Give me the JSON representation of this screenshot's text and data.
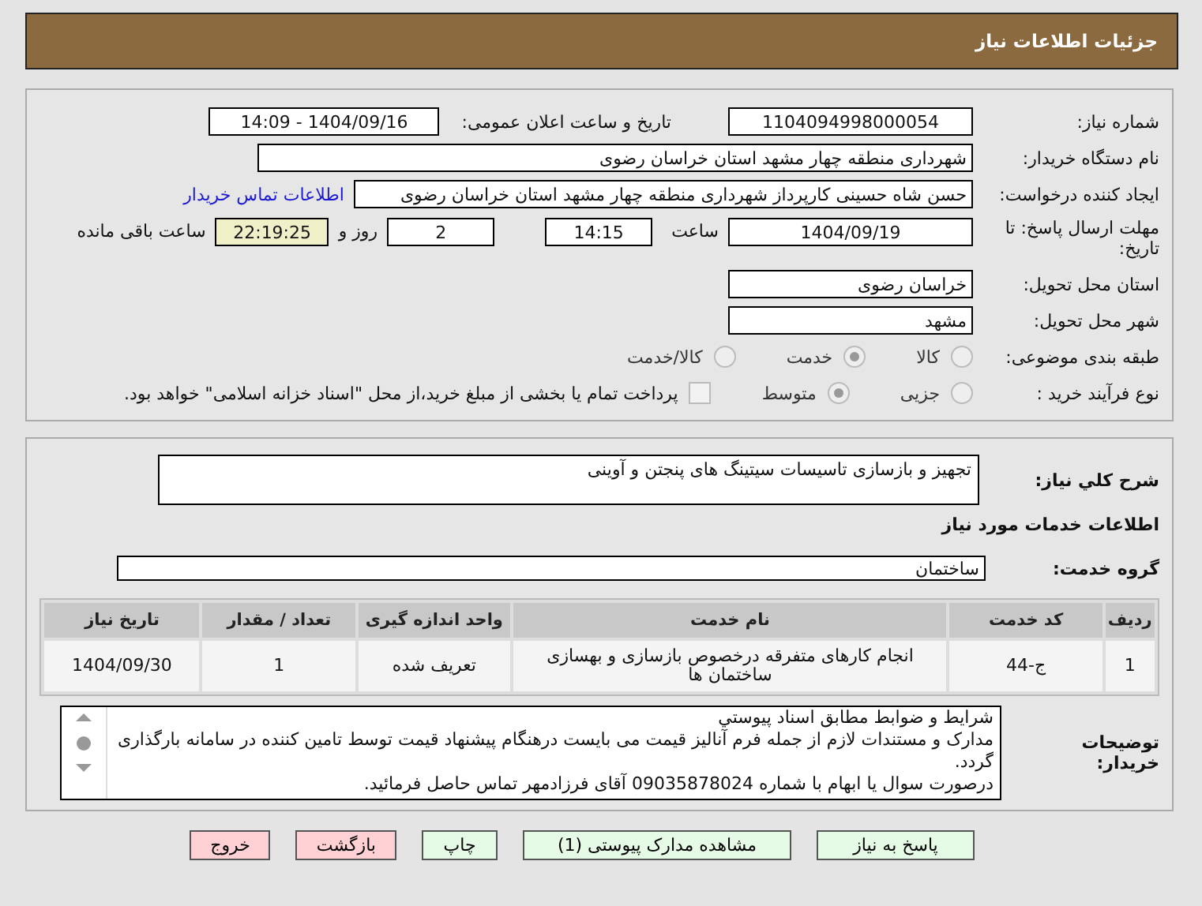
{
  "header": {
    "title": "جزئیات اطلاعات نیاز"
  },
  "details": {
    "need_number": {
      "label": "شماره نیاز:",
      "value": "1104094998000054"
    },
    "announce": {
      "label": "تاریخ و ساعت اعلان عمومی:",
      "value": "1404/09/16 - 14:09"
    },
    "buyer": {
      "label": "نام دستگاه خریدار:",
      "value": "شهرداری منطقه چهار مشهد استان خراسان رضوی"
    },
    "requester": {
      "label": "ایجاد کننده درخواست:",
      "value": "حسن شاه حسینی کارپرداز شهرداری منطقه چهار مشهد استان خراسان رضوی",
      "link": "اطلاعات تماس خریدار"
    },
    "deadline": {
      "label": "مهلت ارسال پاسخ: تا تاریخ:",
      "date": "1404/09/19",
      "time_label": "ساعت",
      "time": "14:15",
      "days": "2",
      "days_label": "روز و",
      "remaining": "22:19:25",
      "remaining_label": "ساعت باقی مانده"
    },
    "province": {
      "label": "استان محل تحویل:",
      "value": "خراسان رضوی"
    },
    "city": {
      "label": "شهر محل تحویل:",
      "value": "مشهد"
    },
    "category": {
      "label": "طبقه بندی موضوعی:",
      "options": [
        {
          "label": "کالا",
          "selected": false
        },
        {
          "label": "خدمت",
          "selected": true
        },
        {
          "label": "کالا/خدمت",
          "selected": false
        }
      ]
    },
    "purchase_type": {
      "label": "نوع فرآیند خرید :",
      "options": [
        {
          "label": "جزیی",
          "selected": false
        },
        {
          "label": "متوسط",
          "selected": true
        }
      ],
      "payment": {
        "checked": false,
        "text": "پرداخت تمام یا بخشی از مبلغ خرید،از محل \"اسناد خزانه اسلامی\" خواهد بود."
      }
    }
  },
  "services": {
    "description": {
      "label": "شرح کلي نياز:",
      "value": "تجهیز و بازسازی تاسیسات سیتینگ های پنجتن و آوینی"
    },
    "section_title": "اطلاعات خدمات مورد نیاز",
    "group": {
      "label": "گروه خدمت:",
      "value": "ساختمان"
    },
    "table": {
      "columns": [
        "ردیف",
        "کد خدمت",
        "نام خدمت",
        "واحد اندازه گیری",
        "تعداد / مقدار",
        "تاریخ نیاز"
      ],
      "rows": [
        [
          "1",
          "ج-44",
          "انجام کارهای متفرقه درخصوص بازسازی و بهسازی ساختمان ها",
          "تعریف شده",
          "1",
          "1404/09/30"
        ]
      ]
    },
    "notes": {
      "label": "توضیحات خریدار:",
      "lines": [
        "شرایط و ضوابط مطابق اسناد پیوستي",
        "مدارک و مستندات لازم از جمله فرم آنالیز قیمت می بایست درهنگام پیشنهاد قیمت توسط تامین کننده در سامانه بارگذاری گردد.",
        "درصورت سوال یا ابهام با شماره 09035878024 آقای فرزادمهر تماس حاصل فرمائید."
      ]
    }
  },
  "buttons": [
    {
      "label": "پاسخ به نیاز",
      "color": "#e6fbe6"
    },
    {
      "label": "مشاهده مدارک پیوستی (1)",
      "color": "#e6fbe6"
    },
    {
      "label": "چاپ",
      "color": "#e6fbe6"
    },
    {
      "label": "بازگشت",
      "color": "#ffd0d4"
    },
    {
      "label": "خروج",
      "color": "#ffd0d4"
    }
  ]
}
